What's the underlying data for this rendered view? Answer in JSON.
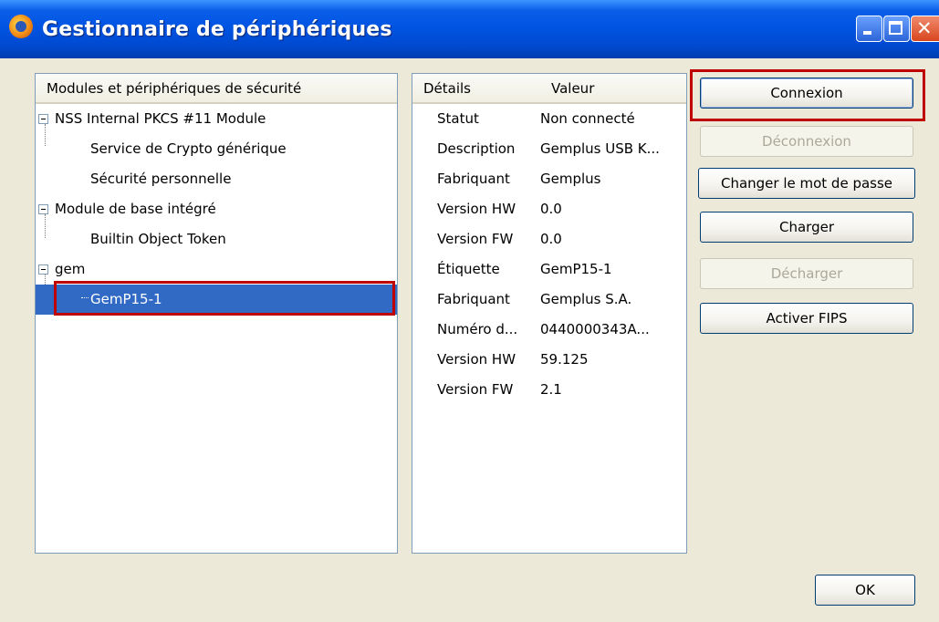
{
  "window": {
    "title": "Gestionnaire de périphériques"
  },
  "tree": {
    "header": "Modules et périphériques de sécurité",
    "items": [
      {
        "label": "NSS Internal PKCS #11 Module",
        "level": 0,
        "expanded": true
      },
      {
        "label": "Service de Crypto générique",
        "level": 1
      },
      {
        "label": "Sécurité personnelle",
        "level": 1
      },
      {
        "label": "Module de base intégré",
        "level": 0,
        "expanded": true
      },
      {
        "label": "Builtin Object Token",
        "level": 1
      },
      {
        "label": "gem",
        "level": 0,
        "expanded": true
      },
      {
        "label": "GemP15-1",
        "level": 1,
        "selected": true
      }
    ]
  },
  "details": {
    "header_key": "Détails",
    "header_value": "Valeur",
    "rows": [
      {
        "key": "Statut",
        "value": "Non connecté"
      },
      {
        "key": "Description",
        "value": "Gemplus USB K..."
      },
      {
        "key": "Fabriquant",
        "value": "Gemplus"
      },
      {
        "key": "Version HW",
        "value": "0.0"
      },
      {
        "key": "Version FW",
        "value": "0.0"
      },
      {
        "key": "Étiquette",
        "value": "GemP15-1"
      },
      {
        "key": "Fabriquant",
        "value": "Gemplus S.A."
      },
      {
        "key": "Numéro d...",
        "value": "0440000343A..."
      },
      {
        "key": "Version HW",
        "value": "59.125"
      },
      {
        "key": "Version FW",
        "value": "2.1"
      }
    ]
  },
  "buttons": {
    "connexion": "Connexion",
    "deconnexion": "Déconnexion",
    "changer_mdp": "Changer le mot de passe",
    "charger": "Charger",
    "decharger": "Décharger",
    "activer_fips": "Activer FIPS",
    "ok": "OK"
  },
  "colors": {
    "selection": "#316ac5",
    "highlight_box": "#c00000",
    "titlebar": "#0054e3"
  }
}
